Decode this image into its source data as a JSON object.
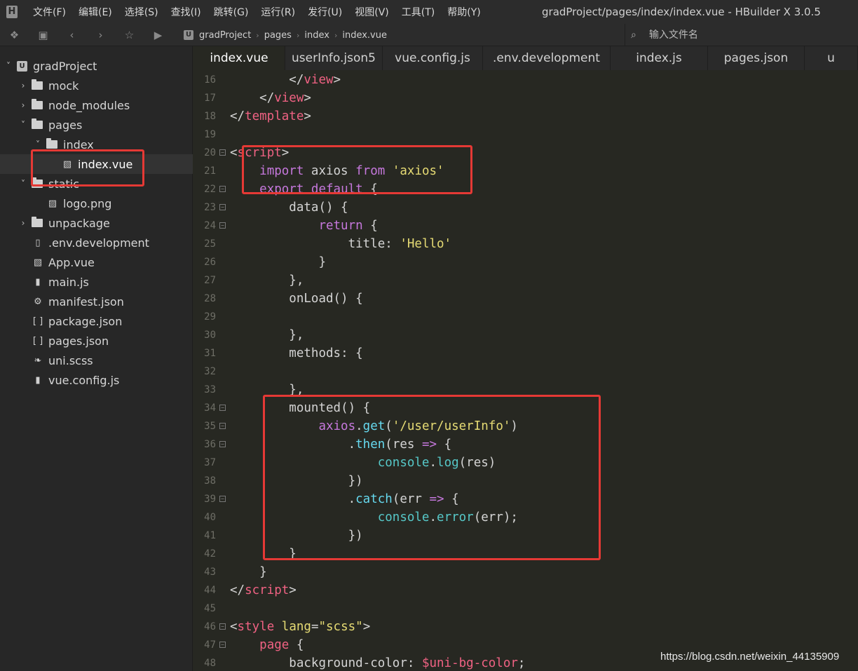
{
  "menubar": {
    "logo": "H",
    "items": [
      "文件(F)",
      "编辑(E)",
      "选择(S)",
      "查找(I)",
      "跳转(G)",
      "运行(R)",
      "发行(U)",
      "视图(V)",
      "工具(T)",
      "帮助(Y)"
    ],
    "window_title": "gradProject/pages/index/index.vue - HBuilder X 3.0.5"
  },
  "toolbar": {
    "icons": [
      "new-file-icon",
      "save-icon",
      "back-icon",
      "forward-icon",
      "star-icon",
      "run-icon"
    ],
    "breadcrumb": [
      "gradProject",
      "pages",
      "index",
      "index.vue"
    ],
    "breadcrumb_logo": "U",
    "file_search_placeholder": "输入文件名"
  },
  "sidebar": {
    "items": [
      {
        "label": "gradProject",
        "type": "project",
        "expanded": true,
        "depth": 0
      },
      {
        "label": "mock",
        "type": "folder",
        "expanded": false,
        "depth": 1
      },
      {
        "label": "node_modules",
        "type": "folder",
        "expanded": false,
        "depth": 1
      },
      {
        "label": "pages",
        "type": "folder",
        "expanded": true,
        "depth": 1
      },
      {
        "label": "index",
        "type": "folder",
        "expanded": true,
        "depth": 2
      },
      {
        "label": "index.vue",
        "type": "vue",
        "selected": true,
        "depth": 3
      },
      {
        "label": "static",
        "type": "folder",
        "expanded": true,
        "depth": 1
      },
      {
        "label": "logo.png",
        "type": "image",
        "depth": 2
      },
      {
        "label": "unpackage",
        "type": "folder",
        "expanded": false,
        "depth": 1
      },
      {
        "label": ".env.development",
        "type": "file",
        "depth": 1
      },
      {
        "label": "App.vue",
        "type": "vue",
        "depth": 1
      },
      {
        "label": "main.js",
        "type": "js",
        "depth": 1
      },
      {
        "label": "manifest.json",
        "type": "manifest",
        "depth": 1
      },
      {
        "label": "package.json",
        "type": "json",
        "depth": 1
      },
      {
        "label": "pages.json",
        "type": "json",
        "depth": 1
      },
      {
        "label": "uni.scss",
        "type": "scss",
        "depth": 1
      },
      {
        "label": "vue.config.js",
        "type": "js",
        "depth": 1
      }
    ]
  },
  "tabs": [
    {
      "label": "index.vue",
      "active": true
    },
    {
      "label": "userInfo.json5",
      "active": false
    },
    {
      "label": "vue.config.js",
      "active": false
    },
    {
      "label": ".env.development",
      "active": false
    },
    {
      "label": "index.js",
      "active": false
    },
    {
      "label": "pages.json",
      "active": false
    },
    {
      "label": "u",
      "active": false
    }
  ],
  "editor": {
    "lines": [
      {
        "n": "16",
        "fold": false,
        "tokens": [
          [
            "        ",
            "punc"
          ],
          [
            "</",
            "punc"
          ],
          [
            "view",
            "tag"
          ],
          [
            ">",
            "punc"
          ]
        ]
      },
      {
        "n": "17",
        "fold": false,
        "tokens": [
          [
            "    ",
            "punc"
          ],
          [
            "</",
            "punc"
          ],
          [
            "view",
            "tag"
          ],
          [
            ">",
            "punc"
          ]
        ]
      },
      {
        "n": "18",
        "fold": false,
        "tokens": [
          [
            "</",
            "punc"
          ],
          [
            "template",
            "tag"
          ],
          [
            ">",
            "punc"
          ]
        ]
      },
      {
        "n": "19",
        "fold": false,
        "tokens": []
      },
      {
        "n": "20",
        "fold": true,
        "tokens": [
          [
            "<",
            "punc"
          ],
          [
            "script",
            "tag"
          ],
          [
            ">",
            "punc"
          ]
        ]
      },
      {
        "n": "21",
        "fold": false,
        "tokens": [
          [
            "    ",
            "punc"
          ],
          [
            "import",
            "kw"
          ],
          [
            " axios ",
            "punc"
          ],
          [
            "from",
            "kw"
          ],
          [
            " ",
            "punc"
          ],
          [
            "'axios'",
            "str"
          ]
        ]
      },
      {
        "n": "22",
        "fold": true,
        "tokens": [
          [
            "    ",
            "punc"
          ],
          [
            "export",
            "kw"
          ],
          [
            " ",
            "punc"
          ],
          [
            "default",
            "kw"
          ],
          [
            " {",
            "punc"
          ]
        ]
      },
      {
        "n": "23",
        "fold": true,
        "tokens": [
          [
            "        ",
            "punc"
          ],
          [
            "data",
            "fn"
          ],
          [
            "() {",
            "punc"
          ]
        ]
      },
      {
        "n": "24",
        "fold": true,
        "tokens": [
          [
            "            ",
            "punc"
          ],
          [
            "return",
            "kw"
          ],
          [
            " {",
            "punc"
          ]
        ]
      },
      {
        "n": "25",
        "fold": false,
        "tokens": [
          [
            "                ",
            "punc"
          ],
          [
            "title",
            "prop"
          ],
          [
            ": ",
            "punc"
          ],
          [
            "'Hello'",
            "str"
          ]
        ]
      },
      {
        "n": "26",
        "fold": false,
        "tokens": [
          [
            "            ",
            "punc"
          ],
          [
            "}",
            "punc"
          ]
        ]
      },
      {
        "n": "27",
        "fold": false,
        "tokens": [
          [
            "        ",
            "punc"
          ],
          [
            "},",
            "punc"
          ]
        ]
      },
      {
        "n": "28",
        "fold": false,
        "tokens": [
          [
            "        ",
            "punc"
          ],
          [
            "onLoad",
            "fn"
          ],
          [
            "() {",
            "punc"
          ]
        ]
      },
      {
        "n": "29",
        "fold": false,
        "tokens": []
      },
      {
        "n": "30",
        "fold": false,
        "tokens": [
          [
            "        ",
            "punc"
          ],
          [
            "},",
            "punc"
          ]
        ]
      },
      {
        "n": "31",
        "fold": false,
        "tokens": [
          [
            "        ",
            "punc"
          ],
          [
            "methods",
            "prop"
          ],
          [
            ": {",
            "punc"
          ]
        ]
      },
      {
        "n": "32",
        "fold": false,
        "tokens": []
      },
      {
        "n": "33",
        "fold": false,
        "tokens": [
          [
            "        ",
            "punc"
          ],
          [
            "},",
            "punc"
          ]
        ]
      },
      {
        "n": "34",
        "fold": true,
        "tokens": [
          [
            "        ",
            "punc"
          ],
          [
            "mounted",
            "fn"
          ],
          [
            "() {",
            "punc"
          ]
        ]
      },
      {
        "n": "35",
        "fold": true,
        "tokens": [
          [
            "            ",
            "punc"
          ],
          [
            "axios",
            "obj"
          ],
          [
            ".",
            "punc"
          ],
          [
            "get",
            "method"
          ],
          [
            "(",
            "punc"
          ],
          [
            "'/user/userInfo'",
            "str"
          ],
          [
            ")",
            "punc"
          ]
        ]
      },
      {
        "n": "36",
        "fold": true,
        "tokens": [
          [
            "                ",
            "punc"
          ],
          [
            ".",
            "punc"
          ],
          [
            "then",
            "method"
          ],
          [
            "(res ",
            "punc"
          ],
          [
            "=>",
            "op"
          ],
          [
            " {",
            "punc"
          ]
        ]
      },
      {
        "n": "37",
        "fold": false,
        "tokens": [
          [
            "                    ",
            "punc"
          ],
          [
            "console",
            "builtin"
          ],
          [
            ".",
            "punc"
          ],
          [
            "log",
            "builtin"
          ],
          [
            "(res)",
            "punc"
          ]
        ]
      },
      {
        "n": "38",
        "fold": false,
        "tokens": [
          [
            "                ",
            "punc"
          ],
          [
            "})",
            "punc"
          ]
        ]
      },
      {
        "n": "39",
        "fold": true,
        "tokens": [
          [
            "                ",
            "punc"
          ],
          [
            ".",
            "punc"
          ],
          [
            "catch",
            "method"
          ],
          [
            "(err ",
            "punc"
          ],
          [
            "=>",
            "op"
          ],
          [
            " {",
            "punc"
          ]
        ]
      },
      {
        "n": "40",
        "fold": false,
        "tokens": [
          [
            "                    ",
            "punc"
          ],
          [
            "console",
            "builtin"
          ],
          [
            ".",
            "punc"
          ],
          [
            "error",
            "builtin"
          ],
          [
            "(err);",
            "punc"
          ]
        ]
      },
      {
        "n": "41",
        "fold": false,
        "tokens": [
          [
            "                ",
            "punc"
          ],
          [
            "})",
            "punc"
          ]
        ]
      },
      {
        "n": "42",
        "fold": false,
        "tokens": [
          [
            "        ",
            "punc"
          ],
          [
            "}",
            "punc"
          ]
        ]
      },
      {
        "n": "43",
        "fold": false,
        "tokens": [
          [
            "    ",
            "punc"
          ],
          [
            "}",
            "punc"
          ]
        ]
      },
      {
        "n": "44",
        "fold": false,
        "tokens": [
          [
            "</",
            "punc"
          ],
          [
            "script",
            "tag"
          ],
          [
            ">",
            "punc"
          ]
        ]
      },
      {
        "n": "45",
        "fold": false,
        "tokens": []
      },
      {
        "n": "46",
        "fold": true,
        "tokens": [
          [
            "<",
            "punc"
          ],
          [
            "style",
            "tag"
          ],
          [
            " ",
            "punc"
          ],
          [
            "lang",
            "str"
          ],
          [
            "=",
            "punc"
          ],
          [
            "\"scss\"",
            "str"
          ],
          [
            ">",
            "punc"
          ]
        ]
      },
      {
        "n": "47",
        "fold": true,
        "tokens": [
          [
            "    ",
            "punc"
          ],
          [
            "page",
            "tag"
          ],
          [
            " {",
            "punc"
          ]
        ]
      },
      {
        "n": "48",
        "fold": false,
        "tokens": [
          [
            "        ",
            "punc"
          ],
          [
            "background-color",
            "prop"
          ],
          [
            ": ",
            "punc"
          ],
          [
            "$uni-bg-color",
            "var"
          ],
          [
            ";",
            "punc"
          ]
        ]
      }
    ]
  },
  "watermark": "https://blog.csdn.net/weixin_44135909",
  "colors": {
    "annotation": "#e53935",
    "editor_bg": "#272822"
  }
}
